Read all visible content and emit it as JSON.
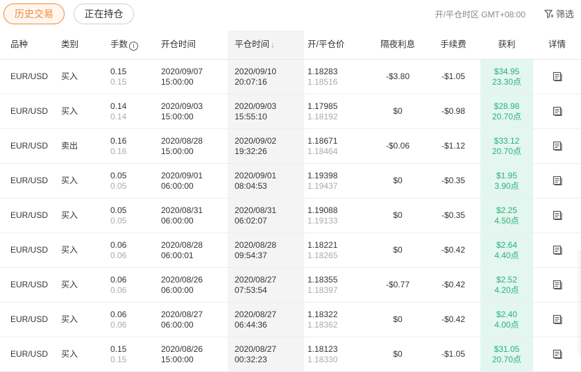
{
  "tabs": {
    "history": "历史交易",
    "positions": "正在持仓"
  },
  "timezone": "开/平仓时区 GMT+08:00",
  "filter_label": "筛选",
  "columns": {
    "symbol": "品种",
    "type": "类别",
    "lots": "手数",
    "open_time": "开仓时间",
    "close_time": "平仓时间",
    "price": "开/平仓价",
    "swap": "隔夜利息",
    "fee": "手续费",
    "profit": "获利",
    "detail": "详情"
  },
  "rows": [
    {
      "symbol": "EUR/USD",
      "type": "买入",
      "lots": "0.15",
      "lots_closed": "0.15",
      "open_date": "2020/09/07",
      "open_time": "15:00:00",
      "close_date": "2020/09/10",
      "close_time": "20:07:16",
      "open_price": "1.18283",
      "close_price": "1.18516",
      "swap": "-$3.80",
      "fee": "-$1.05",
      "profit": "$34.95",
      "pips": "23.30点"
    },
    {
      "symbol": "EUR/USD",
      "type": "买入",
      "lots": "0.14",
      "lots_closed": "0.14",
      "open_date": "2020/09/03",
      "open_time": "15:00:00",
      "close_date": "2020/09/03",
      "close_time": "15:55:10",
      "open_price": "1.17985",
      "close_price": "1.18192",
      "swap": "$0",
      "fee": "-$0.98",
      "profit": "$28.98",
      "pips": "20.70点"
    },
    {
      "symbol": "EUR/USD",
      "type": "卖出",
      "lots": "0.16",
      "lots_closed": "0.16",
      "open_date": "2020/08/28",
      "open_time": "15:00:00",
      "close_date": "2020/09/02",
      "close_time": "19:32:26",
      "open_price": "1.18671",
      "close_price": "1.18464",
      "swap": "-$0.06",
      "fee": "-$1.12",
      "profit": "$33.12",
      "pips": "20.70点"
    },
    {
      "symbol": "EUR/USD",
      "type": "买入",
      "lots": "0.05",
      "lots_closed": "0.05",
      "open_date": "2020/09/01",
      "open_time": "06:00:00",
      "close_date": "2020/09/01",
      "close_time": "08:04:53",
      "open_price": "1.19398",
      "close_price": "1.19437",
      "swap": "$0",
      "fee": "-$0.35",
      "profit": "$1.95",
      "pips": "3.90点"
    },
    {
      "symbol": "EUR/USD",
      "type": "买入",
      "lots": "0.05",
      "lots_closed": "0.05",
      "open_date": "2020/08/31",
      "open_time": "06:00:00",
      "close_date": "2020/08/31",
      "close_time": "06:02:07",
      "open_price": "1.19088",
      "close_price": "1.19133",
      "swap": "$0",
      "fee": "-$0.35",
      "profit": "$2.25",
      "pips": "4.50点"
    },
    {
      "symbol": "EUR/USD",
      "type": "买入",
      "lots": "0.06",
      "lots_closed": "0.06",
      "open_date": "2020/08/28",
      "open_time": "06:00:01",
      "close_date": "2020/08/28",
      "close_time": "09:54:37",
      "open_price": "1.18221",
      "close_price": "1.18265",
      "swap": "$0",
      "fee": "-$0.42",
      "profit": "$2.64",
      "pips": "4.40点"
    },
    {
      "symbol": "EUR/USD",
      "type": "买入",
      "lots": "0.06",
      "lots_closed": "0.06",
      "open_date": "2020/08/26",
      "open_time": "06:00:00",
      "close_date": "2020/08/27",
      "close_time": "07:53:54",
      "open_price": "1.18355",
      "close_price": "1.18397",
      "swap": "-$0.77",
      "fee": "-$0.42",
      "profit": "$2.52",
      "pips": "4.20点"
    },
    {
      "symbol": "EUR/USD",
      "type": "买入",
      "lots": "0.06",
      "lots_closed": "0.06",
      "open_date": "2020/08/27",
      "open_time": "06:00:00",
      "close_date": "2020/08/27",
      "close_time": "06:44:36",
      "open_price": "1.18322",
      "close_price": "1.18362",
      "swap": "$0",
      "fee": "-$0.42",
      "profit": "$2.40",
      "pips": "4.00点"
    },
    {
      "symbol": "EUR/USD",
      "type": "买入",
      "lots": "0.15",
      "lots_closed": "0.15",
      "open_date": "2020/08/26",
      "open_time": "15:00:00",
      "close_date": "2020/08/27",
      "close_time": "00:32:23",
      "open_price": "1.18123",
      "close_price": "1.18330",
      "swap": "$0",
      "fee": "-$1.05",
      "profit": "$31.05",
      "pips": "20.70点"
    }
  ],
  "colors": {
    "accent": "#f08a3c",
    "profit": "#29b07c",
    "profit_bg": "#e3f6ef"
  },
  "icons": {
    "info": "info-icon",
    "sort": "sort-down-arrow-icon",
    "filter": "filter-icon",
    "detail": "document-icon"
  }
}
